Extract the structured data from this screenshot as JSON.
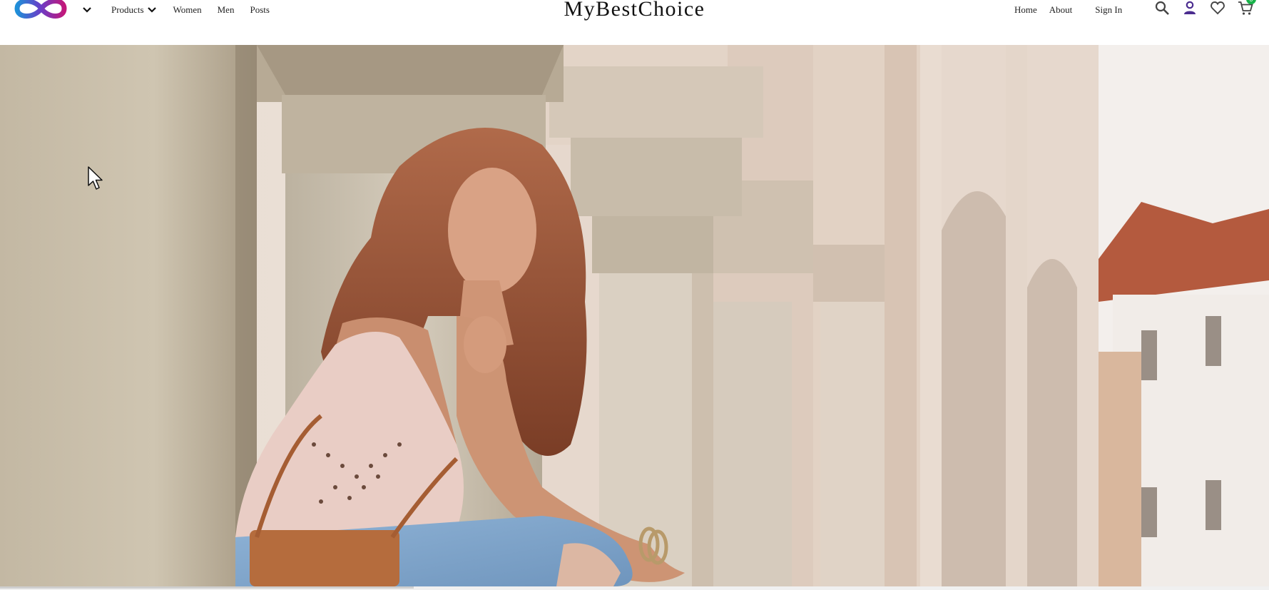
{
  "brand": {
    "name": "MyBestChoice"
  },
  "nav_left": {
    "products": "Products",
    "women": "Women",
    "men": "Men",
    "posts": "Posts"
  },
  "nav_right": {
    "home": "Home",
    "about": "About",
    "sign_in": "Sign In"
  },
  "icons": {
    "logo": "brand-logo",
    "menu_toggle": "chevron-down-icon",
    "search": "search-icon",
    "account": "user-icon",
    "wishlist": "heart-icon",
    "cart": "cart-icon"
  },
  "cart": {
    "count": "0"
  },
  "colors": {
    "logo_blue": "#1f8fd8",
    "logo_magenta": "#c2187a",
    "account_icon": "#4b2c8f",
    "cart_badge": "#19b34a"
  }
}
